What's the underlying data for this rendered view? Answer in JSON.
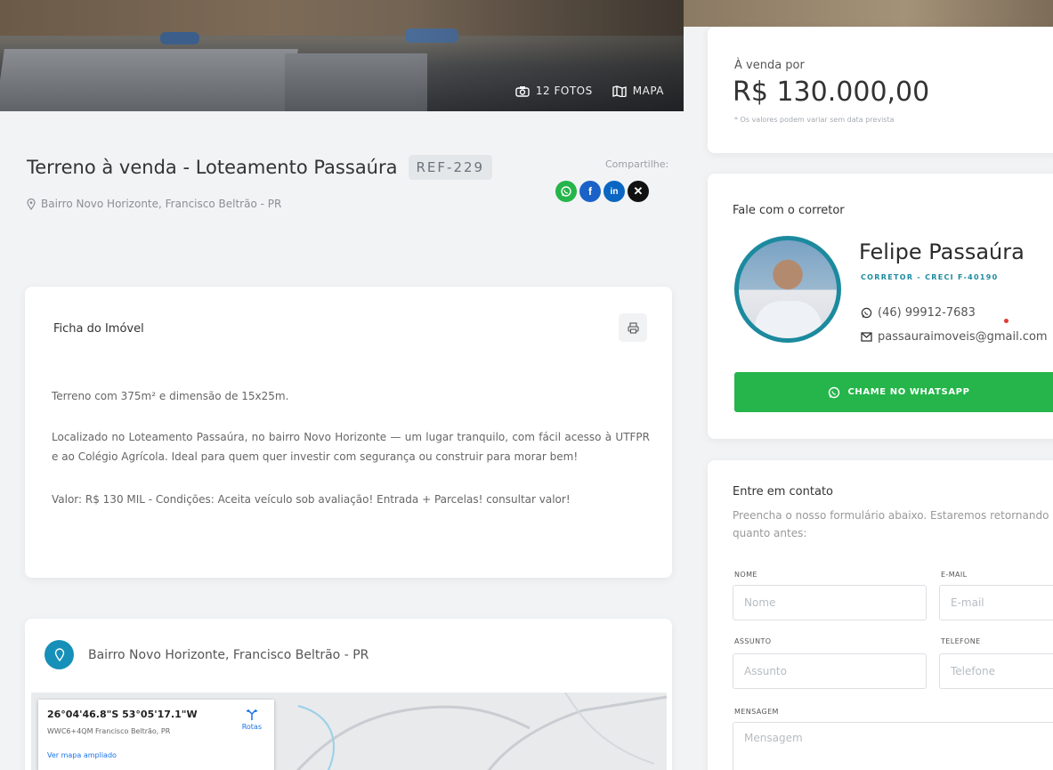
{
  "hero": {
    "photos_label": "12 FOTOS",
    "map_label": "MAPA"
  },
  "property": {
    "title": "Terreno à venda - Loteamento Passaúra",
    "ref": "REF-229",
    "address": "Bairro Novo Horizonte, Francisco Beltrão - PR",
    "share_label": "Compartilhe:"
  },
  "share_buttons": [
    "whatsapp-icon",
    "facebook-icon",
    "linkedin-icon",
    "x-icon"
  ],
  "ficha": {
    "title": "Ficha do Imóvel",
    "p1": "Terreno com 375m² e dimensão de 15x25m.",
    "p2": "Localizado no Loteamento Passaúra, no bairro Novo Horizonte — um lugar tranquilo, com fácil acesso à UTFPR e ao Colégio Agrícola. Ideal para quem quer investir com segurança ou construir para morar bem!",
    "p3": "Valor: R$ 130 MIL - Condições: Aceita veículo sob avaliação! Entrada + Parcelas! consultar valor!"
  },
  "location": {
    "address": "Bairro Novo Horizonte, Francisco Beltrão - PR",
    "coords": "26°04'46.8\"S 53°05'17.1\"W",
    "plus_code": "WWC6+4QM Francisco Beltrão, PR",
    "big_map": "Ver mapa ampliado",
    "routes": "Rotas"
  },
  "price": {
    "label": "À venda por",
    "value": "R$ 130.000,00",
    "note": "* Os valores podem variar sem data prevista"
  },
  "broker": {
    "heading": "Fale com o corretor",
    "name": "Felipe Passaúra",
    "creci": "CORRETOR - CRECI F-40190",
    "phone": "(46) 99912-7683",
    "email": "passauraimoveis@gmail.com",
    "whatsapp_button": "CHAME NO WHATSAPP"
  },
  "contact": {
    "heading": "Entre em contato",
    "subtitle": "Preencha o nosso formulário abaixo. Estaremos retornando o quanto antes:",
    "name_label": "NOME",
    "name_placeholder": "Nome",
    "email_label": "E-MAIL",
    "email_placeholder": "E-mail",
    "subject_label": "ASSUNTO",
    "subject_placeholder": "Assunto",
    "phone_label": "TELEFONE",
    "phone_placeholder": "Telefone",
    "message_label": "MENSAGEM",
    "message_placeholder": "Mensagem"
  },
  "colors": {
    "whatsapp": "#25b54a",
    "facebook": "#1b62c8",
    "linkedin": "#0a66c2",
    "x": "#111111",
    "accent": "#1c8a9e"
  }
}
